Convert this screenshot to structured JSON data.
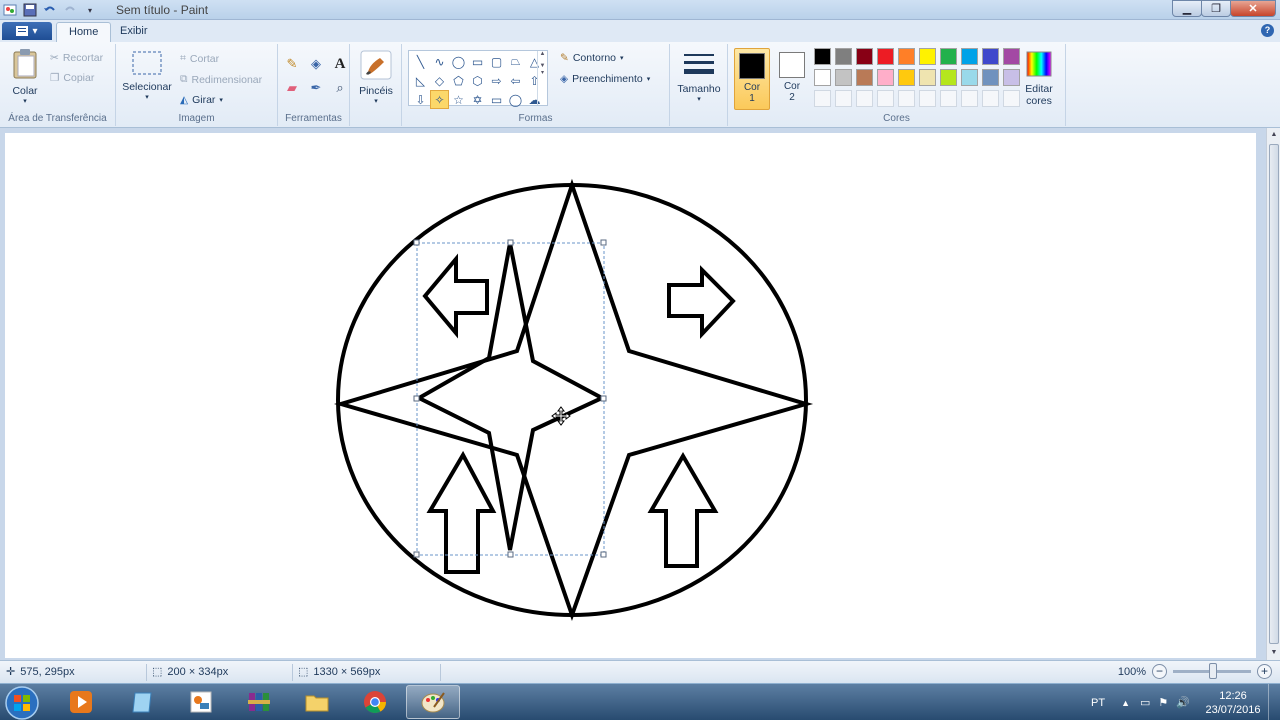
{
  "window": {
    "title": "Sem título - Paint"
  },
  "tabs": [
    {
      "label": "Home"
    },
    {
      "label": "Exibir"
    }
  ],
  "ribbon": {
    "clipboard": {
      "paste": "Colar",
      "cut": "Recortar",
      "copy": "Copiar",
      "label": "Área de Transferência"
    },
    "image": {
      "select": "Selecionar",
      "crop": "Cortar",
      "resize": "Redimensionar",
      "rotate": "Girar",
      "label": "Imagem"
    },
    "tools": {
      "label": "Ferramentas"
    },
    "brushes": {
      "label": "Pincéis"
    },
    "shapes": {
      "outline": "Contorno",
      "fill": "Preenchimento",
      "label": "Formas"
    },
    "size": {
      "label": "Tamanho"
    },
    "colors": {
      "color1_label": "Cor",
      "color1_num": "1",
      "color2_label": "Cor",
      "color2_num": "2",
      "edit_label": "Editar",
      "edit_label2": "cores",
      "label": "Cores",
      "color1": "#000000",
      "color2": "#ffffff",
      "palette_row1": [
        "#000000",
        "#7f7f7f",
        "#880015",
        "#ed1c24",
        "#ff7f27",
        "#fff200",
        "#22b14c",
        "#00a2e8",
        "#3f48cc",
        "#a349a4"
      ],
      "palette_row2": [
        "#ffffff",
        "#c3c3c3",
        "#b97a57",
        "#ffaec9",
        "#ffc90e",
        "#efe4b0",
        "#b5e61d",
        "#99d9ea",
        "#7092be",
        "#c8bfe7"
      ]
    }
  },
  "status": {
    "cursor_pos": "575, 295px",
    "selection_size": "200 × 334px",
    "canvas_size": "1330 × 569px",
    "zoom": "100%"
  },
  "tray": {
    "language": "PT",
    "time": "12:26",
    "date": "23/07/2016"
  },
  "canvas_drawing": {
    "shapes": [
      "circle",
      "four-point-star-large",
      "four-point-star-small",
      "arrow-left",
      "arrow-right",
      "arrow-up",
      "arrow-up"
    ],
    "stroke_color": "#000000"
  }
}
